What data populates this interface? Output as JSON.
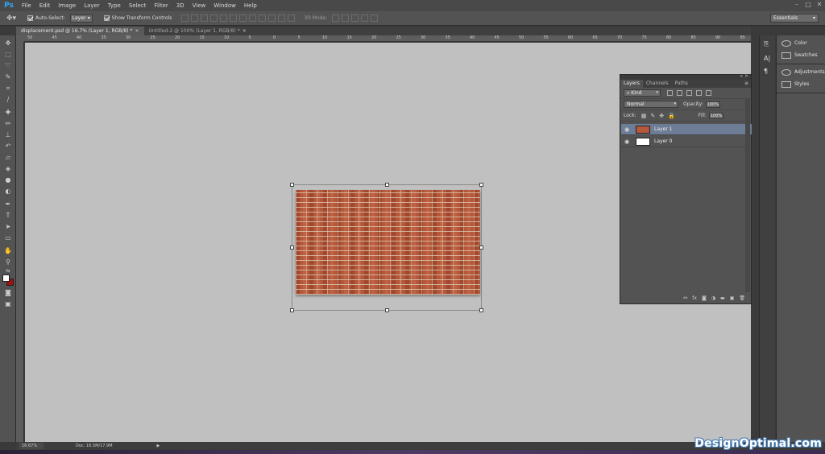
{
  "app": {
    "logo": "Ps"
  },
  "menu": [
    "File",
    "Edit",
    "Image",
    "Layer",
    "Type",
    "Select",
    "Filter",
    "3D",
    "View",
    "Window",
    "Help"
  ],
  "window_controls": [
    "–",
    "□",
    "✕"
  ],
  "options_bar": {
    "auto_select_label": "Auto-Select:",
    "auto_select_value": "Layer",
    "transform_label": "Show Transform Controls",
    "mode_3d_label": "3D Mode:",
    "workspace": "Essentials"
  },
  "tabs": [
    {
      "label": "displacement.psd @ 16.7% (Layer 1, RGB/8) *",
      "active": true
    },
    {
      "label": "Untitled-2 @ 100% (Layer 1, RGB/8) *",
      "active": false
    }
  ],
  "ruler_marks": [
    "50",
    "45",
    "40",
    "35",
    "30",
    "25",
    "20",
    "15",
    "10",
    "5",
    "0",
    "5",
    "10",
    "15",
    "20",
    "25",
    "30",
    "35",
    "40",
    "45",
    "50",
    "55",
    "60",
    "65",
    "70",
    "75",
    "80",
    "85",
    "90",
    "95"
  ],
  "layers_panel": {
    "tabs": [
      "Layers",
      "Channels",
      "Paths"
    ],
    "menu_icon": "≡",
    "filter_kind": "Kind",
    "blend_mode": "Normal",
    "opacity_label": "Opacity:",
    "opacity_value": "100%",
    "lock_label": "Lock:",
    "fill_label": "Fill:",
    "fill_value": "100%",
    "layers": [
      {
        "name": "Layer 1",
        "selected": true,
        "thumbnail": "brick"
      },
      {
        "name": "Layer 0",
        "selected": false,
        "thumbnail": "white"
      }
    ],
    "footer_icons": [
      "link-icon",
      "fx-icon",
      "mask-icon",
      "adjustment-icon",
      "folder-icon",
      "new-layer-icon",
      "trash-icon"
    ]
  },
  "dock": {
    "items": [
      "Color",
      "Swatches",
      "Adjustments",
      "Styles"
    ]
  },
  "status": {
    "zoom": "16.67%",
    "doc_info": "Doc: 16.5M/17.9M"
  },
  "watermark": "DesignOptimal.com",
  "colors": {
    "foreground": "#ffffff",
    "background": "#a0100d",
    "selected_layer": "#6d7d95",
    "canvas": "#c0c0c0"
  }
}
